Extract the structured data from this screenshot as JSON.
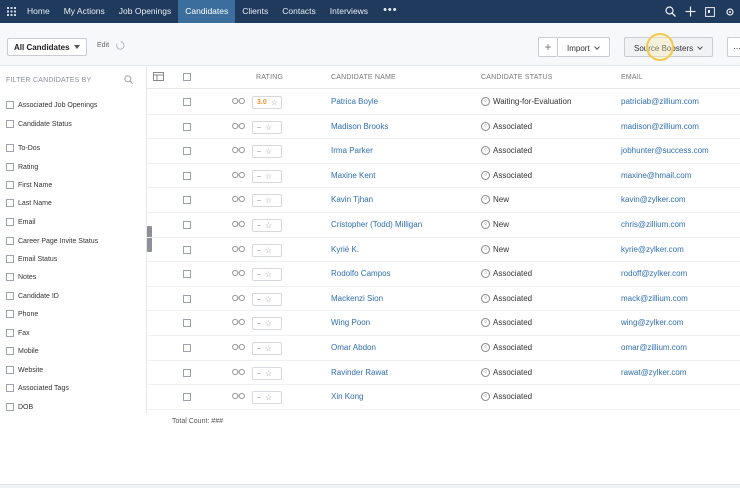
{
  "nav": {
    "items": [
      {
        "label": "Home",
        "active": false
      },
      {
        "label": "My Actions",
        "active": false
      },
      {
        "label": "Job Openings",
        "active": false
      },
      {
        "label": "Candidates",
        "active": true
      },
      {
        "label": "Clients",
        "active": false
      },
      {
        "label": "Contacts",
        "active": false
      },
      {
        "label": "Interviews",
        "active": false
      }
    ],
    "more": "•••",
    "icons": [
      "apps-grid-icon",
      "search-icon",
      "add-icon",
      "calendar-icon",
      "settings-icon"
    ]
  },
  "toolbar": {
    "view_label": "All Candidates",
    "edit_label": "Edit",
    "plus_label": "+",
    "import_label": "Import",
    "source_label": "Source Boosters",
    "more_label": "..."
  },
  "sidebar": {
    "heading": "FILTER CANDIDATES BY",
    "filters": [
      "Associated Job Openings",
      "Candidate Status",
      "To-Dos",
      "Rating",
      "First Name",
      "Last Name",
      "Email",
      "Career Page Invite Status",
      "Email Status",
      "Notes",
      "Candidate ID",
      "Phone",
      "Fax",
      "Mobile",
      "Website",
      "Associated Tags",
      "DOB"
    ]
  },
  "table": {
    "headers": {
      "rating": "RATING",
      "name": "CANDIDATE NAME",
      "status": "CANDIDATE STATUS",
      "email": "EMAIL"
    },
    "rows": [
      {
        "rating": "3.0",
        "name": "Patrica Boyle",
        "status": "Waiting-for-Evaluation",
        "email": "patriciab@zillium.com"
      },
      {
        "rating": "–",
        "name": "Madison Brooks",
        "status": "Associated",
        "email": "madison@zillium.com"
      },
      {
        "rating": "–",
        "name": "Irma Parker",
        "status": "Associated",
        "email": "jobhunter@success.com"
      },
      {
        "rating": "–",
        "name": "Maxine Kent",
        "status": "Associated",
        "email": "maxine@hmail.com"
      },
      {
        "rating": "–",
        "name": "Kavin Tjhan",
        "status": "New",
        "email": "kavin@zylker.com"
      },
      {
        "rating": "–",
        "name": "Cristopher (Todd) Milligan",
        "status": "New",
        "email": "chris@zillium.com"
      },
      {
        "rating": "–",
        "name": "Kyrié K.",
        "status": "New",
        "email": "kyrie@zylker.com"
      },
      {
        "rating": "–",
        "name": "Rodolfo Campos",
        "status": "Associated",
        "email": "rodoff@zylker.com"
      },
      {
        "rating": "–",
        "name": "Mackenzi Sion",
        "status": "Associated",
        "email": "mack@zillium.com"
      },
      {
        "rating": "–",
        "name": "Wing Poon",
        "status": "Associated",
        "email": "wing@zylker.com"
      },
      {
        "rating": "–",
        "name": "Omar Abdon",
        "status": "Associated",
        "email": "omar@zillium.com"
      },
      {
        "rating": "–",
        "name": "Ravinder Rawat",
        "status": "Associated",
        "email": "rawat@zylker.com"
      },
      {
        "rating": "–",
        "name": "Xin Kong",
        "status": "Associated",
        "email": ""
      }
    ]
  },
  "footer": {
    "total_label": "Total Count: ###"
  },
  "colors": {
    "nav_bg": "#1f3a5c",
    "nav_active": "#3b6e9c",
    "link": "#2f6fb3",
    "rating": "#e8932b",
    "cursor_ring": "#f2c94c"
  }
}
